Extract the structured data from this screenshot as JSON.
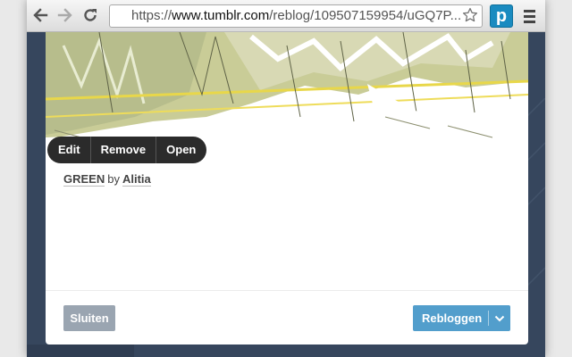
{
  "browser": {
    "url_prefix": "https://",
    "url_domain": "www.tumblr.com",
    "url_path": "/reblog/109507159954/uGQ7P...",
    "extension_letter": "p",
    "icons": [
      "back-arrow-icon",
      "forward-arrow-icon",
      "reload-icon",
      "star-icon",
      "extension-icon",
      "menu-icon"
    ]
  },
  "editor": {
    "buttons": [
      "Edit",
      "Remove",
      "Open"
    ]
  },
  "post": {
    "title": "GREEN",
    "by": "by",
    "author": "Alitia"
  },
  "footer": {
    "close_label": "Sluiten",
    "reblog_label": "Rebloggen"
  },
  "colors": {
    "dashboard_bg": "#36465d",
    "reblog_blue": "#529ecc",
    "close_gray": "#9aa5b1",
    "edit_bar": "#2b2b2b"
  }
}
